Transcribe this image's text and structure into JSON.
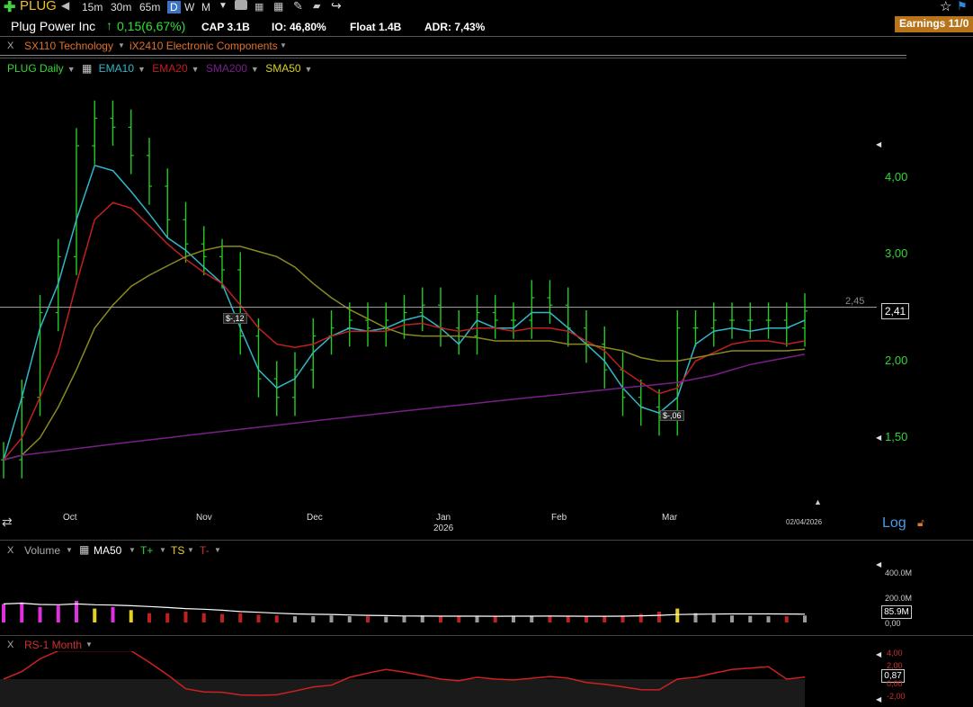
{
  "toolbar": {
    "symbol": "PLUG",
    "timeframes": [
      "15m",
      "30m",
      "65m",
      "D",
      "W",
      "M"
    ],
    "active_timeframe": "D"
  },
  "header": {
    "company": "Plug Power Inc",
    "change": "0,15(6,67%)",
    "cap": "CAP 3.1B",
    "io": "IO: 46,80%",
    "float": "Float 1.4B",
    "adr": "ADR: 7,43%",
    "earnings": "Earnings 11/0"
  },
  "sectors": {
    "sector": "SX110 Technology",
    "industry": "iX2410 Electronic Components"
  },
  "legend": {
    "chart_label": "PLUG Daily",
    "ema10": "EMA10",
    "ema20": "EMA20",
    "sma200": "SMA200",
    "sma50": "SMA50"
  },
  "colors": {
    "up": "#22cc22",
    "down": "#22cc22",
    "ema10": "#30b8c8",
    "ema20": "#c02020",
    "sma200": "#7a1f8a",
    "sma50": "#8a8a20",
    "accent": "#3a72c8"
  },
  "price_axis": {
    "ticks": [
      "4,00",
      "3,00",
      "2,00",
      "1,50"
    ],
    "current": "2,41",
    "reference": "2,45"
  },
  "annotations": {
    "low1": "$-,12",
    "low2": "$-,06"
  },
  "x_axis": {
    "months": [
      "Oct",
      "Nov",
      "Dec",
      "Jan",
      "Feb",
      "Mar"
    ],
    "year": "2026",
    "date": "02/04/2026",
    "scale_button": "Log"
  },
  "volume_panel": {
    "label": "Volume",
    "ma": "MA50",
    "t_plus": "T+",
    "ts": "TS",
    "t_minus": "T-",
    "ticks": [
      "400.0M",
      "200.0M",
      "0,00"
    ],
    "current": "85.9M"
  },
  "rs_panel": {
    "label": "RS-1 Month",
    "ticks": [
      "4,00",
      "2,00",
      "0,00",
      "-2,00"
    ],
    "current": "0,87"
  },
  "chart_data": {
    "type": "line",
    "title": "PLUG Daily",
    "ylim": [
      1.4,
      4.6
    ],
    "series": [
      {
        "name": "EMA10",
        "values": [
          1.6,
          1.9,
          2.3,
          2.6,
          3.1,
          3.6,
          3.55,
          3.35,
          3.15,
          2.95,
          2.85,
          2.72,
          2.6,
          2.3,
          2.05,
          1.95,
          2.0,
          2.15,
          2.25,
          2.3,
          2.28,
          2.3,
          2.35,
          2.38,
          2.3,
          2.2,
          2.35,
          2.3,
          2.3,
          2.4,
          2.4,
          2.3,
          2.2,
          2.1,
          1.95,
          1.85,
          1.82,
          1.9,
          2.2,
          2.28,
          2.3,
          2.28,
          2.3,
          2.3,
          2.35
        ]
      },
      {
        "name": "EMA20",
        "values": [
          1.6,
          1.7,
          1.9,
          2.15,
          2.6,
          3.1,
          3.25,
          3.2,
          3.05,
          2.9,
          2.78,
          2.68,
          2.6,
          2.45,
          2.3,
          2.2,
          2.18,
          2.2,
          2.25,
          2.28,
          2.28,
          2.28,
          2.32,
          2.33,
          2.3,
          2.28,
          2.3,
          2.3,
          2.28,
          2.3,
          2.3,
          2.28,
          2.22,
          2.16,
          2.05,
          1.98,
          1.92,
          1.95,
          2.1,
          2.15,
          2.2,
          2.22,
          2.22,
          2.2,
          2.22
        ]
      },
      {
        "name": "SMA50",
        "values": [
          1.6,
          1.62,
          1.7,
          1.85,
          2.05,
          2.3,
          2.45,
          2.58,
          2.66,
          2.73,
          2.8,
          2.85,
          2.88,
          2.88,
          2.84,
          2.8,
          2.72,
          2.6,
          2.5,
          2.42,
          2.36,
          2.3,
          2.26,
          2.25,
          2.25,
          2.25,
          2.24,
          2.22,
          2.22,
          2.22,
          2.22,
          2.2,
          2.2,
          2.18,
          2.16,
          2.12,
          2.1,
          2.1,
          2.12,
          2.14,
          2.16,
          2.16,
          2.16,
          2.16,
          2.17
        ]
      },
      {
        "name": "SMA200",
        "values": [
          1.6,
          1.62,
          1.63,
          1.64,
          1.65,
          1.66,
          1.67,
          1.68,
          1.69,
          1.7,
          1.71,
          1.72,
          1.73,
          1.74,
          1.75,
          1.76,
          1.77,
          1.78,
          1.79,
          1.8,
          1.81,
          1.82,
          1.83,
          1.84,
          1.85,
          1.86,
          1.87,
          1.88,
          1.89,
          1.9,
          1.91,
          1.92,
          1.93,
          1.94,
          1.95,
          1.96,
          1.97,
          1.98,
          2.0,
          2.02,
          2.05,
          2.08,
          2.1,
          2.12,
          2.14
        ]
      }
    ],
    "price_values": [
      1.6,
      1.9,
      2.4,
      2.8,
      3.8,
      4.1,
      4.0,
      3.7,
      3.4,
      3.1,
      2.9,
      2.8,
      2.7,
      2.25,
      2.0,
      1.9,
      2.05,
      2.25,
      2.3,
      2.35,
      2.3,
      2.35,
      2.4,
      2.45,
      2.3,
      2.25,
      2.4,
      2.35,
      2.35,
      2.5,
      2.45,
      2.3,
      2.2,
      2.05,
      1.9,
      1.85,
      1.8,
      2.3,
      2.3,
      2.35,
      2.35,
      2.35,
      2.35,
      2.3,
      2.41
    ],
    "volume_values": [
      120,
      130,
      100,
      110,
      140,
      90,
      100,
      80,
      60,
      60,
      70,
      60,
      55,
      60,
      50,
      45,
      40,
      40,
      45,
      40,
      40,
      38,
      40,
      45,
      42,
      40,
      38,
      40,
      42,
      44,
      40,
      38,
      40,
      42,
      45,
      55,
      70,
      90,
      60,
      50,
      45,
      42,
      40,
      40,
      45
    ]
  }
}
